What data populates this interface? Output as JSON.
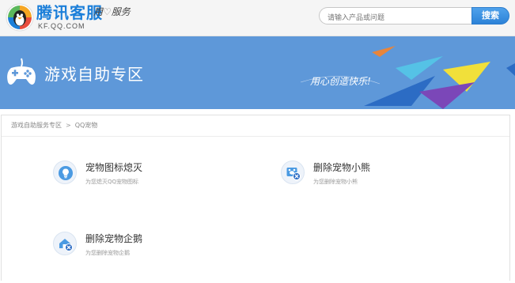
{
  "header": {
    "brand_name": "腾讯客服",
    "brand_url": "KF.QQ.COM",
    "slogan_left": "用",
    "slogan_right": "服务",
    "search": {
      "placeholder": "请输入产品或问题",
      "button_label": "搜索"
    }
  },
  "banner": {
    "title": "游戏自助专区",
    "slogan": "用心创造快乐!"
  },
  "breadcrumb": {
    "parent": "游戏自助服务专区",
    "separator": ">",
    "current": "QQ宠物"
  },
  "services": [
    {
      "title": "宠物图标熄灭",
      "desc": "为您熄灭QQ宠物图标",
      "icon": "lightbulb-icon"
    },
    {
      "title": "删除宠物小熊",
      "desc": "为您删除宠物小熊",
      "icon": "delete-bear-icon"
    },
    {
      "title": "删除宠物企鹅",
      "desc": "为您删除宠物企鹅",
      "icon": "delete-penguin-icon"
    }
  ],
  "colors": {
    "brand_blue": "#1c7fd9",
    "banner_blue": "#5e98d9",
    "search_button": "#2c82d8"
  }
}
